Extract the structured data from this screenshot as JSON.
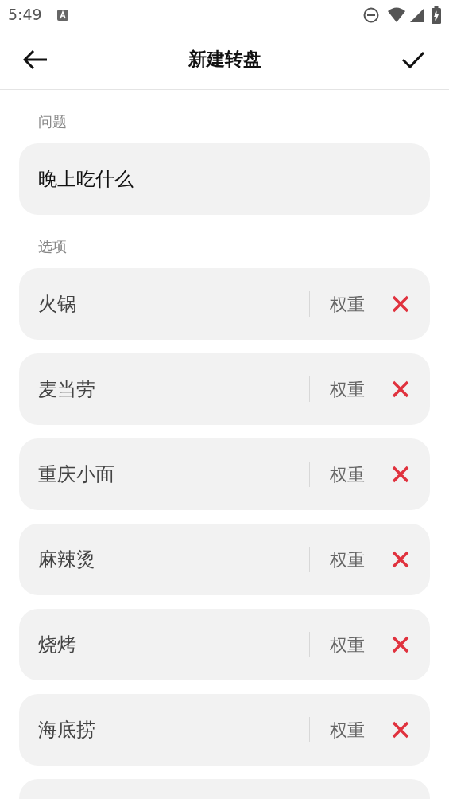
{
  "status_bar": {
    "time": "5:49"
  },
  "header": {
    "title": "新建转盘"
  },
  "question": {
    "label": "问题",
    "value": "晚上吃什么"
  },
  "options": {
    "label": "选项",
    "items": [
      {
        "name": "火锅",
        "weight_placeholder": "权重"
      },
      {
        "name": "麦当劳",
        "weight_placeholder": "权重"
      },
      {
        "name": "重庆小面",
        "weight_placeholder": "权重"
      },
      {
        "name": "麻辣烫",
        "weight_placeholder": "权重"
      },
      {
        "name": "烧烤",
        "weight_placeholder": "权重"
      },
      {
        "name": "海底捞",
        "weight_placeholder": "权重"
      }
    ]
  }
}
